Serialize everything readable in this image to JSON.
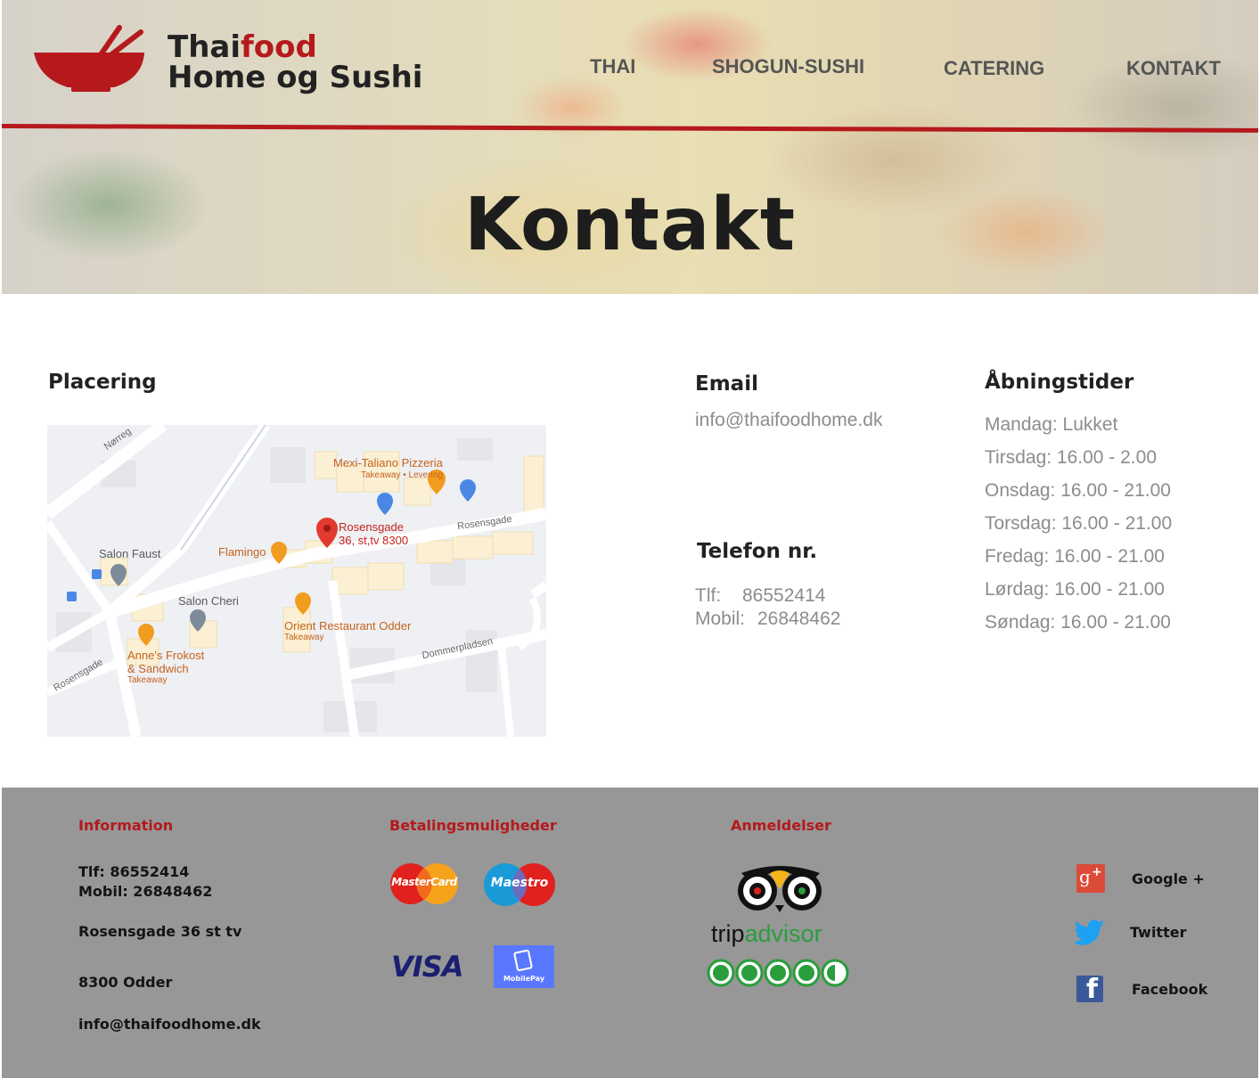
{
  "brand": {
    "name_part1": "Thai",
    "name_accent": "food",
    "name_line2": "Home og Sushi",
    "accent_color": "#b5191c"
  },
  "nav": {
    "items": [
      {
        "label": "THAI"
      },
      {
        "label": "SHOGUN-SUSHI"
      },
      {
        "label": "CATERING"
      },
      {
        "label": "KONTAKT"
      }
    ]
  },
  "hero": {
    "title": "Kontakt"
  },
  "location": {
    "heading": "Placering",
    "map": {
      "pin_label_line1": "Rosensgade",
      "pin_label_line2": "36, st,tv 8300",
      "places": [
        {
          "name": "Mexi-Taliano Pizzeria",
          "sub": "Takeaway • Levering"
        },
        {
          "name": "Salon Faust",
          "sub": ""
        },
        {
          "name": "Flamingo",
          "sub": ""
        },
        {
          "name": "Salon Cheri",
          "sub": ""
        },
        {
          "name": "Orient Restaurant Odder",
          "sub": "Takeaway"
        },
        {
          "name": "Anne's Frokost",
          "name2": "& Sandwich",
          "sub": "Takeaway"
        }
      ],
      "streets": [
        "Nørreg",
        "Rosensgade",
        "Rosensgade",
        "Dommerpladsen"
      ]
    }
  },
  "email": {
    "heading": "Email",
    "value": "info@thaifoodhome.dk"
  },
  "phone": {
    "heading": "Telefon nr.",
    "tlf_label": "Tlf:",
    "tlf_value": "86552414",
    "mobil_label": "Mobil:",
    "mobil_value": "26848462"
  },
  "hours": {
    "heading": "Åbningstider",
    "rows": [
      "Mandag: Lukket",
      "Tirsdag: 16.00 - 2.00",
      "Onsdag: 16.00 - 21.00",
      "Torsdag: 16.00 - 21.00",
      "Fredag: 16.00 - 21.00",
      "Lørdag: 16.00 - 21.00",
      "Søndag: 16.00 - 21.00"
    ]
  },
  "footer": {
    "info": {
      "heading": "Information",
      "tlf": "Tlf: 86552414",
      "mobil": "Mobil: 26848462",
      "address": "Rosensgade 36 st tv",
      "city": "8300 Odder",
      "email": "info@thaifoodhome.dk"
    },
    "payment": {
      "heading": "Betalingsmuligheder",
      "mastercard": "MasterCard",
      "maestro": "Maestro",
      "visa": "VISA",
      "mobilepay": "MobilePay"
    },
    "reviews": {
      "heading": "Anmeldelser",
      "trip": "trip",
      "advisor": "advisor",
      "rating_out_of_5": 4.5
    },
    "social": [
      {
        "label": "Google +",
        "icon": "google-plus-icon"
      },
      {
        "label": "Twitter",
        "icon": "twitter-icon"
      },
      {
        "label": "Facebook",
        "icon": "facebook-icon"
      }
    ],
    "background_color": "#979797"
  }
}
